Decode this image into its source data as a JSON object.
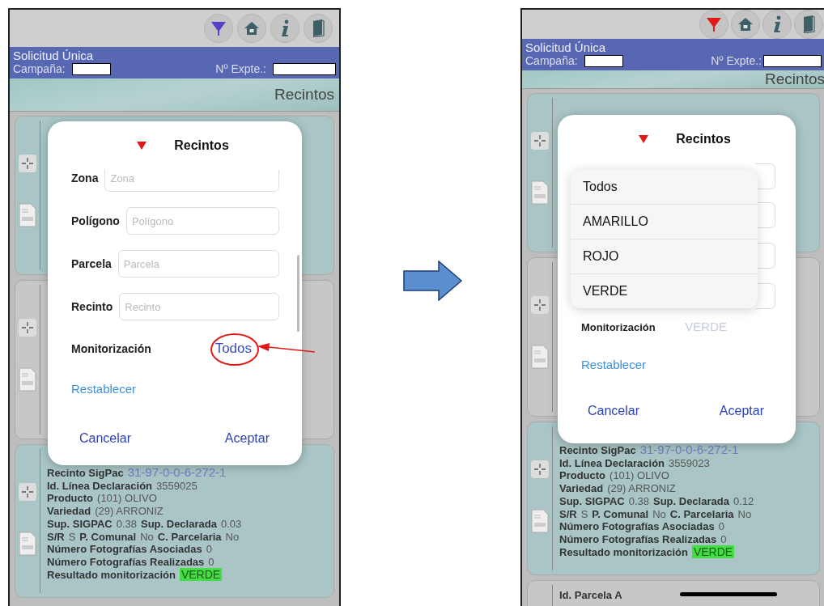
{
  "phones": [
    {
      "filter_active": false,
      "highlight_monitor_value": true,
      "home_indicator": false,
      "header": {
        "title": "Solicitud Única",
        "campaign_label": "Campaña:",
        "file_label": "Nº Expte.:"
      },
      "banner": "Recintos",
      "cards": [
        {
          "kind": "covered"
        },
        {
          "kind": "covered"
        },
        {
          "kind": "detail",
          "lines": [
            [
              {
                "label": "Recinto SigPac",
                "value": "31-97-0-0-6-272-1",
                "kind": "link"
              }
            ],
            [
              {
                "label": "Id. Línea Declaración",
                "value": "3559025",
                "kind": "plain"
              }
            ],
            [
              {
                "label": "Producto",
                "value": "(101) OLIVO",
                "kind": "plain"
              }
            ],
            [
              {
                "label": "Variedad",
                "value": "(29) ARRONIZ",
                "kind": "plain"
              }
            ],
            [
              {
                "label": "Sup. SIGPAC",
                "value": "0.38",
                "kind": "plain"
              },
              {
                "label": "Sup. Declarada",
                "value": "0.03",
                "kind": "plain"
              }
            ],
            [
              {
                "label": "S/R",
                "value": "S",
                "kind": "plain"
              },
              {
                "label": "P. Comunal",
                "value": "No",
                "kind": "plain"
              },
              {
                "label": "C. Parcelaria",
                "value": "No",
                "kind": "plain"
              }
            ],
            [
              {
                "label": "Número Fotografías Asociadas",
                "value": "0",
                "kind": "plain"
              }
            ],
            [
              {
                "label": "Número Fotografías Realizadas",
                "value": "0",
                "kind": "plain"
              }
            ],
            [
              {
                "label": "Resultado monitorización",
                "value": "VERDE",
                "kind": "status",
                "color": "#44dd44"
              }
            ]
          ]
        }
      ],
      "dialog": {
        "title": "Recintos",
        "fields": [
          {
            "label": "Zona",
            "placeholder": "Zona"
          },
          {
            "label": "Polígono",
            "placeholder": "Polígono"
          },
          {
            "label": "Parcela",
            "placeholder": "Parcela"
          },
          {
            "label": "Recinto",
            "placeholder": "Recinto"
          }
        ],
        "monitor_label": "Monitorización",
        "monitor_value": "Todos",
        "monitor_value_disabled": false,
        "reset": "Restablecer",
        "cancel": "Cancelar",
        "accept": "Aceptar"
      }
    },
    {
      "filter_active": true,
      "highlight_monitor_value": false,
      "home_indicator": true,
      "header": {
        "title": "Solicitud Única",
        "campaign_label": "Campaña:",
        "file_label": "Nº Expte.:"
      },
      "banner": "Recintos",
      "cards": [
        {
          "kind": "covered"
        },
        {
          "kind": "covered"
        },
        {
          "kind": "detail",
          "lines": [
            [
              {
                "label": "Recinto SigPac",
                "value": "31-97-0-0-6-272-1",
                "kind": "link"
              }
            ],
            [
              {
                "label": "Id. Línea Declaración",
                "value": "3559023",
                "kind": "plain"
              }
            ],
            [
              {
                "label": "Producto",
                "value": "(101) OLIVO",
                "kind": "plain"
              }
            ],
            [
              {
                "label": "Variedad",
                "value": "(29) ARRONIZ",
                "kind": "plain"
              }
            ],
            [
              {
                "label": "Sup. SIGPAC",
                "value": "0.38",
                "kind": "plain"
              },
              {
                "label": "Sup. Declarada",
                "value": "0.12",
                "kind": "plain"
              }
            ],
            [
              {
                "label": "S/R",
                "value": "S",
                "kind": "plain"
              },
              {
                "label": "P. Comunal",
                "value": "No",
                "kind": "plain"
              },
              {
                "label": "C. Parcelaria",
                "value": "No",
                "kind": "plain"
              }
            ],
            [
              {
                "label": "Número Fotografías Asociadas",
                "value": "0",
                "kind": "plain"
              }
            ],
            [
              {
                "label": "Número Fotografías Realizadas",
                "value": "0",
                "kind": "plain"
              }
            ],
            [
              {
                "label": "Resultado monitorización",
                "value": "VERDE",
                "kind": "status",
                "color": "#44dd44"
              }
            ]
          ]
        },
        {
          "kind": "partial",
          "lines": [
            [
              {
                "label": "Id. Parcela A"
              }
            ]
          ]
        }
      ],
      "dialog": {
        "title": "Recintos",
        "dropdown": [
          {
            "label": "Todos"
          },
          {
            "label": "AMARILLO"
          },
          {
            "label": "ROJO"
          },
          {
            "label": "VERDE"
          }
        ],
        "monitor_label": "Monitorización",
        "monitor_value": "VERDE",
        "monitor_value_disabled": true,
        "reset": "Restablecer",
        "cancel": "Cancelar",
        "accept": "Aceptar"
      }
    }
  ]
}
